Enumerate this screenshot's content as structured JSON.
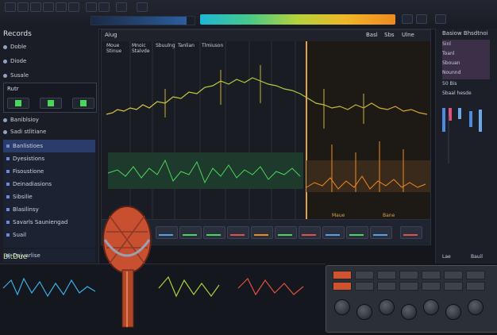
{
  "colors": {
    "accent_blue": "#2a3c6a",
    "green": "#4cd55b",
    "orange": "#ef8a20",
    "red": "#d0522f",
    "lime": "#b5d33a"
  },
  "sidebar": {
    "title": "Records",
    "items": [
      {
        "label": "Doble",
        "icon": "circle-icon"
      },
      {
        "label": "Diode",
        "icon": "circle-icon"
      },
      {
        "label": "Susale",
        "icon": "circle-icon"
      }
    ],
    "box_label": "Rutr",
    "section_label": "Baniblsioy",
    "sub_label": "Sadi stlitiane",
    "list": [
      {
        "label": "Banlistioes",
        "selected": true
      },
      {
        "label": "Dyesistions",
        "selected": false
      },
      {
        "label": "Fisoustione",
        "selected": false
      },
      {
        "label": "Deinadiasions",
        "selected": false
      },
      {
        "label": "Sibsilie",
        "selected": false
      },
      {
        "label": "Blasilinsy",
        "selected": false
      },
      {
        "label": "Savarls Sauniengad",
        "selected": false
      },
      {
        "label": "Suail",
        "selected": false
      },
      {
        "label": "Daivarlise",
        "selected": false
      }
    ],
    "footer_label": "BitDue"
  },
  "editor": {
    "title": "Aiug",
    "lanes": [
      {
        "label": "Moue\nStinue"
      },
      {
        "label": "Mnoic\nStalvde"
      },
      {
        "label": "Sbuulng"
      },
      {
        "label": "Tanlian"
      },
      {
        "label": "Tlmiuson"
      }
    ],
    "header_right": [
      "Basl",
      "Sbs",
      "Ulne"
    ],
    "foot_labels": [
      "Maue",
      "Bane"
    ]
  },
  "right": {
    "title": "Basiow Bhsdtnoi",
    "labels": [
      "Sinl",
      "Toanl",
      "Sbouan",
      "Nounnd",
      "50 Bis",
      "Sbaal hesde"
    ],
    "foot": [
      "Lae",
      "Bauil"
    ]
  },
  "icons": [
    "microphone-icon",
    "knob-icon",
    "menu-icon",
    "search-icon",
    "play-icon"
  ]
}
